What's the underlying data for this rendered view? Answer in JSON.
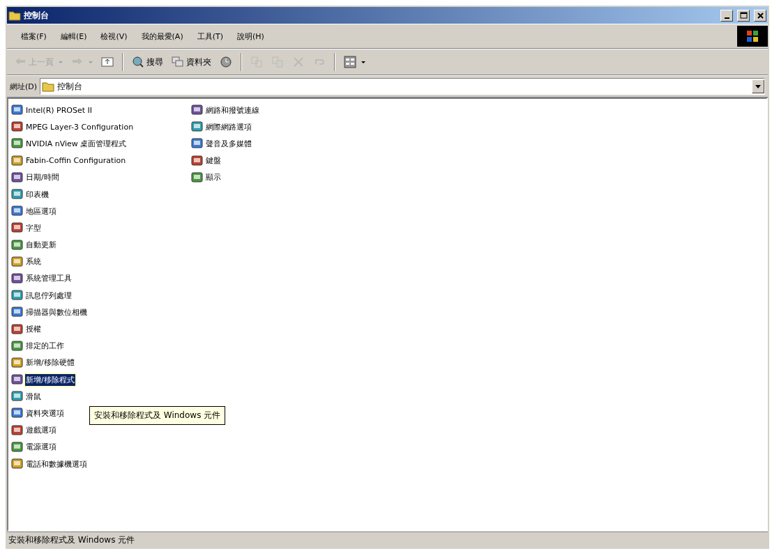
{
  "window": {
    "title": "控制台"
  },
  "menu": [
    "檔案(F)",
    "編輯(E)",
    "檢視(V)",
    "我的最愛(A)",
    "工具(T)",
    "說明(H)"
  ],
  "toolbar": [
    {
      "kind": "back",
      "label": "上一頁",
      "disabled": true
    },
    {
      "kind": "forward",
      "disabled": true
    },
    {
      "kind": "up",
      "disabled": false
    },
    {
      "kind": "sep"
    },
    {
      "kind": "search",
      "label": "搜尋",
      "disabled": false
    },
    {
      "kind": "folders",
      "label": "資料夾",
      "disabled": false
    },
    {
      "kind": "history",
      "disabled": false
    },
    {
      "kind": "sep"
    },
    {
      "kind": "move",
      "disabled": true
    },
    {
      "kind": "copy",
      "disabled": true
    },
    {
      "kind": "delete",
      "disabled": true
    },
    {
      "kind": "undo",
      "disabled": true
    },
    {
      "kind": "sep"
    },
    {
      "kind": "views",
      "disabled": false
    }
  ],
  "address": {
    "label": "網址(D)",
    "value": "控制台"
  },
  "items": [
    {
      "label": "Intel(R) PROSet II",
      "selected": false
    },
    {
      "label": "MPEG Layer-3 Configuration",
      "selected": false
    },
    {
      "label": "NVIDIA nView 桌面管理程式",
      "selected": false
    },
    {
      "label": "Fabin-Coffin Configuration",
      "selected": false
    },
    {
      "label": "日期/時間",
      "selected": false
    },
    {
      "label": "印表機",
      "selected": false
    },
    {
      "label": "地區選項",
      "selected": false
    },
    {
      "label": "字型",
      "selected": false
    },
    {
      "label": "自動更新",
      "selected": false
    },
    {
      "label": "系統",
      "selected": false
    },
    {
      "label": "系統管理工具",
      "selected": false
    },
    {
      "label": "訊息佇列處理",
      "selected": false
    },
    {
      "label": "掃描器與數位相機",
      "selected": false
    },
    {
      "label": "授權",
      "selected": false
    },
    {
      "label": "排定的工作",
      "selected": false
    },
    {
      "label": "新增/移除硬體",
      "selected": false
    },
    {
      "label": "新增/移除程式",
      "selected": true
    },
    {
      "label": "滑鼠",
      "selected": false
    },
    {
      "label": "資料夾選項",
      "selected": false
    },
    {
      "label": "遊戲選項",
      "selected": false
    },
    {
      "label": "電源選項",
      "selected": false
    },
    {
      "label": "電話和數據機選項",
      "selected": false
    },
    {
      "label": "網路和撥號連線",
      "selected": false
    },
    {
      "label": "網際網路選項",
      "selected": false
    },
    {
      "label": "聲音及多媒體",
      "selected": false
    },
    {
      "label": "鍵盤",
      "selected": false
    },
    {
      "label": "顯示",
      "selected": false
    }
  ],
  "tooltip": "安裝和移除程式及 Windows 元件",
  "status_bar": "安裝和移除程式及 Windows 元件"
}
